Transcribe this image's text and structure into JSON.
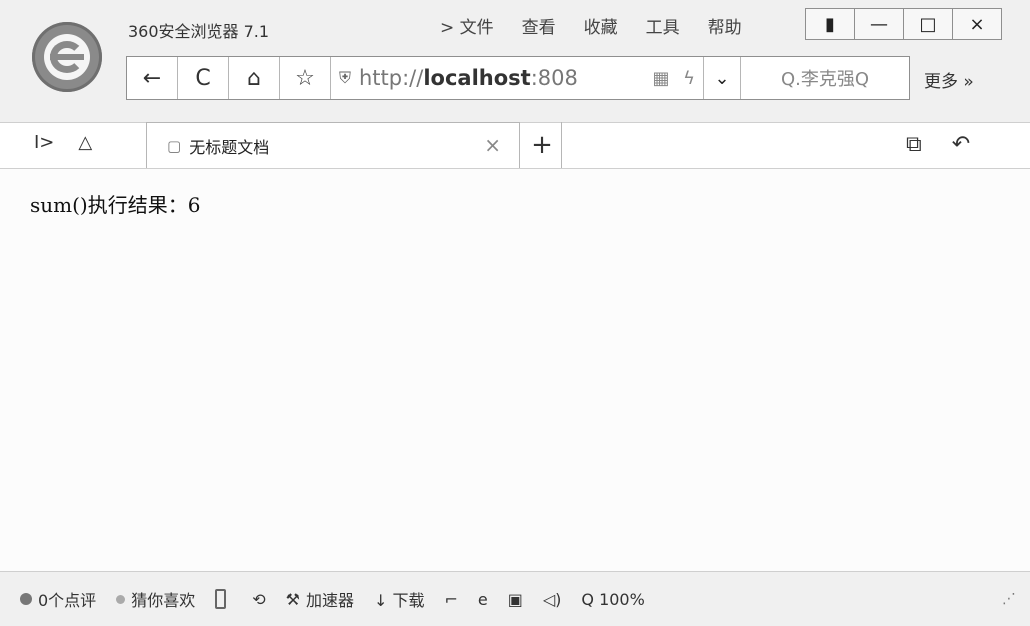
{
  "window": {
    "title": "360安全浏览器 7.1",
    "menu": [
      "> 文件",
      "查看",
      "收藏",
      "工具",
      "帮助"
    ],
    "controls": {
      "skin": "▮",
      "minimize": "—",
      "maximize": "□",
      "close": "×"
    }
  },
  "navigation": {
    "back": "←",
    "refresh": "C",
    "home": "⌂",
    "favorite": "☆",
    "shield": "⛨",
    "url_prefix": "http://",
    "url_host": "localhost",
    "url_suffix": ":808",
    "qr": "▦",
    "bolt": "ϟ",
    "dropdown": "⌄",
    "search_text": "Q.李克强Q",
    "more": "更多 »"
  },
  "tabs": {
    "left_icons": [
      "I>",
      "△"
    ],
    "active": {
      "icon": "▢",
      "title": "无标题文档",
      "close": "×"
    },
    "new": "+",
    "right_icons": [
      "⧉",
      "↶"
    ]
  },
  "page": {
    "result_text": "sum()执行结果：6"
  },
  "status": {
    "ratings": "0个点评",
    "guess": "猜你喜欢",
    "phone": "",
    "speed_icon": "⟲",
    "accelerator": "加速器",
    "download": "↓ 下载",
    "icon1": "⌐",
    "icon2": "e",
    "icon3": "▣",
    "sound": "◁)",
    "zoom": "Q 100%",
    "grip": "⋰"
  }
}
